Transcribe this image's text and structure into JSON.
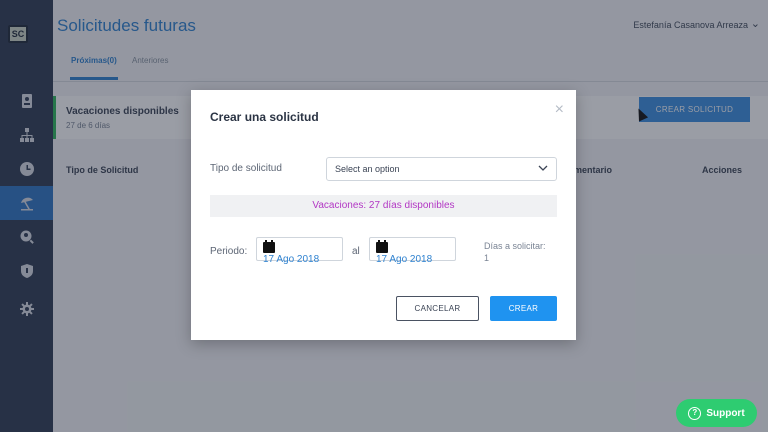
{
  "sidebar": {
    "logo": "SC",
    "items": [
      {
        "icon": "contact-card-icon",
        "active": false
      },
      {
        "icon": "org-chart-icon",
        "active": false
      },
      {
        "icon": "clock-icon",
        "active": false
      },
      {
        "icon": "beach-umbrella-icon",
        "active": true
      },
      {
        "icon": "user-search-icon",
        "active": false
      },
      {
        "icon": "shield-icon",
        "active": false
      },
      {
        "icon": "gear-icon",
        "active": false
      }
    ]
  },
  "header": {
    "title": "Solicitudes futuras",
    "user": "Estefanía Casanova Arreaza"
  },
  "tabs": [
    {
      "label": "Próximas(0)",
      "active": true
    },
    {
      "label": "Anteriores",
      "active": false
    }
  ],
  "summary": {
    "label": "Vacaciones disponibles",
    "sub": "27 de 6 días"
  },
  "toolbar": {
    "create_label": "CREAR SOLICITUD"
  },
  "table": {
    "columns": [
      "Tipo de Solicitud",
      "mentario",
      "Acciones"
    ]
  },
  "modal": {
    "title": "Crear una solicitud",
    "close": "×",
    "type_label": "Tipo de solicitud",
    "type_placeholder": "Select an option",
    "info": "Vacaciones: 27 días disponibles",
    "period_label": "Periodo:",
    "date_from": "17 Ago 2018",
    "al_label": "al",
    "date_to": "17 Ago 2018",
    "days_label": "Días a solicitar:",
    "days_value": "1",
    "cancel_label": "CANCELAR",
    "create_label": "CREAR"
  },
  "support": {
    "label": "Support"
  },
  "colors": {
    "accent": "#2f82d0",
    "sidebar": "#2f3b52",
    "info_text": "#b237c4",
    "support": "#2ecc71"
  }
}
